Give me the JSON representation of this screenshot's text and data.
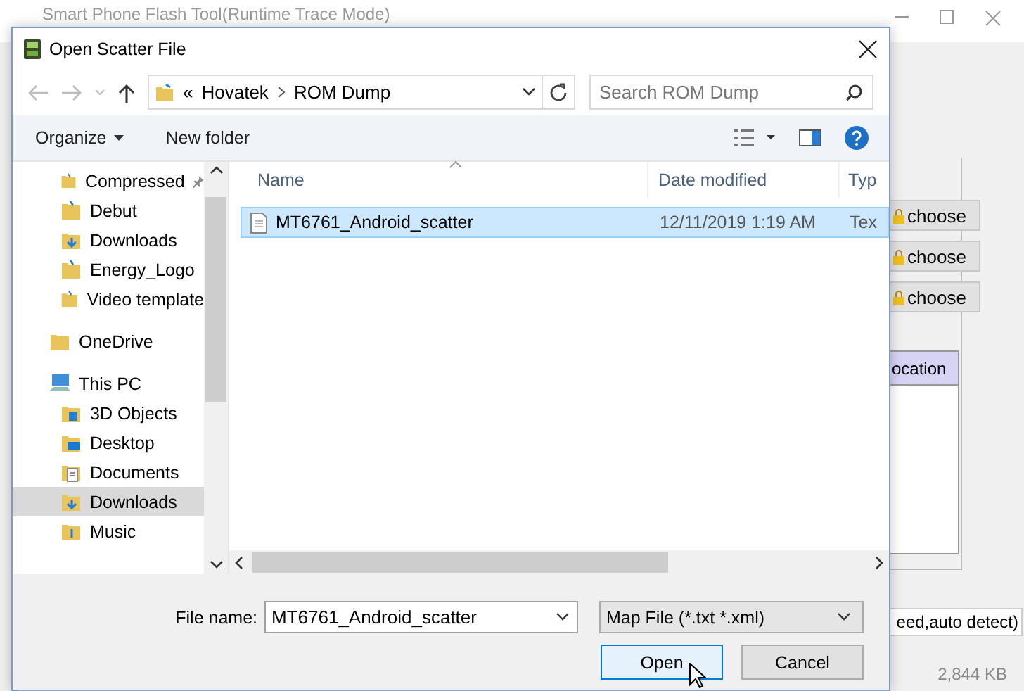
{
  "background_window": {
    "title": "Smart Phone Flash Tool(Runtime Trace Mode)",
    "choose_buttons": [
      "choose",
      "choose",
      "choose"
    ],
    "table": {
      "columns": [
        "ocation"
      ]
    },
    "status_text": "eed,auto detect)",
    "size": "2,844 KB"
  },
  "dialog": {
    "title": "Open Scatter File",
    "address": {
      "overflow": "«",
      "path": [
        "Hovatek",
        "ROM Dump"
      ]
    },
    "search": {
      "placeholder": "Search ROM Dump"
    },
    "toolbar": {
      "organize": "Organize",
      "new_folder": "New folder"
    },
    "quick_access_items": [
      {
        "label": "Compressed",
        "kind": "folder",
        "pinned": true,
        "selected": false
      },
      {
        "label": "Debut",
        "kind": "folder",
        "pinned": false,
        "selected": false
      },
      {
        "label": "Downloads",
        "kind": "downloads",
        "pinned": false,
        "selected": false
      },
      {
        "label": "Energy_Logo",
        "kind": "folder",
        "pinned": false,
        "selected": false
      },
      {
        "label": "Video template",
        "kind": "folder",
        "pinned": false,
        "selected": false
      }
    ],
    "tree": [
      {
        "label": "OneDrive",
        "kind": "cloud",
        "selected": false
      },
      {
        "label": "This PC",
        "kind": "pc",
        "selected": false,
        "children": [
          {
            "label": "3D Objects",
            "kind": "objects",
            "selected": false
          },
          {
            "label": "Desktop",
            "kind": "desktop",
            "selected": false
          },
          {
            "label": "Documents",
            "kind": "documents",
            "selected": false
          },
          {
            "label": "Downloads",
            "kind": "downloads",
            "selected": true
          },
          {
            "label": "Music",
            "kind": "music",
            "selected": false
          }
        ]
      }
    ],
    "file_list": {
      "columns": [
        "Name",
        "Date modified",
        "Typ"
      ],
      "rows": [
        {
          "name": "MT6761_Android_scatter",
          "date_modified": "12/11/2019 1:19 AM",
          "type": "Tex",
          "selected": true
        }
      ]
    },
    "file_name": {
      "label": "File name:",
      "value": "MT6761_Android_scatter"
    },
    "file_type": {
      "value": "Map File (*.txt *.xml)"
    },
    "buttons": [
      {
        "label": "Open",
        "kind": "primary"
      },
      {
        "label": "Cancel",
        "kind": "secondary"
      }
    ]
  }
}
